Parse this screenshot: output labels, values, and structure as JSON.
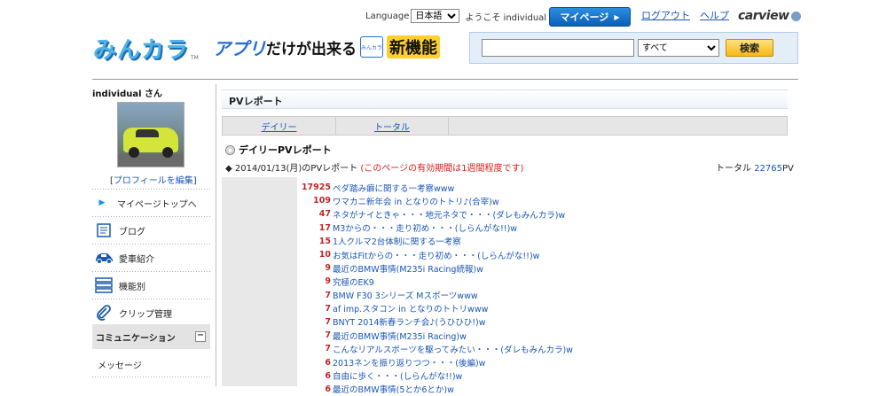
{
  "topbar": {
    "language_label": "Language",
    "language_value": "日本語",
    "welcome": "ようこそ individual さん",
    "mypage_label": "マイページ",
    "logout_label": "ログアウト",
    "help_label": "ヘルプ",
    "carview_logo": "carview"
  },
  "header": {
    "logo_text": "みんカラ",
    "logo_tm": "TM",
    "banner_part1": "アプリ",
    "banner_part2": "だけが出来る",
    "banner_icon_text": "みんカラ",
    "banner_part3": "新機能",
    "search_select_value": "すべて",
    "search_button_label": "検索"
  },
  "sidebar": {
    "user_name": "individual さん",
    "edit_profile_prefix": "[",
    "edit_profile_label": "プロフィールを編集",
    "edit_profile_suffix": "]",
    "items": [
      {
        "label": "マイページトップへ",
        "icon": "triangle-right-icon"
      },
      {
        "label": "ブログ",
        "icon": "notepad-icon"
      },
      {
        "label": "愛車紹介",
        "icon": "car-icon"
      },
      {
        "label": "機能別",
        "icon": "list-icon"
      },
      {
        "label": "クリップ管理",
        "icon": "paperclip-icon"
      }
    ],
    "community_header": "コミュニケーション",
    "community_collapse": "−",
    "message_label": "メッセージ"
  },
  "main": {
    "section_title": "PVレポート",
    "tabs": [
      "デイリー",
      "トータル"
    ],
    "report_heading": "デイリーPVレポート",
    "date_line": "◆ 2014/01/13(月)のPVレポート",
    "date_note": "(このページの有効期間は1週間程度です)",
    "total_label": "トータル",
    "total_value": "22765",
    "total_unit": "PV",
    "rows": [
      {
        "count": "17925",
        "title": "ペダ踏み癖に関する一考察www"
      },
      {
        "count": "109",
        "title": "ワマカニ新年会 in となりのトトリ♪(合宰)w"
      },
      {
        "count": "47",
        "title": "ネタがナイときゃ・・・地元ネタで・・・(ダレもみんカラ)w"
      },
      {
        "count": "17",
        "title": "M3からの・・・走り初め・・・(しらんがな!!)w"
      },
      {
        "count": "15",
        "title": "1人クルマ2台体制に関する一考察"
      },
      {
        "count": "10",
        "title": "お気はFitからの・・・走り初め・・・(しらんがな!!)w"
      },
      {
        "count": "9",
        "title": "最近のBMW事情(M235i Racing続報)w"
      },
      {
        "count": "9",
        "title": "究極のEK9"
      },
      {
        "count": "7",
        "title": "BMW F30 3シリーズ Mスポーツwww"
      },
      {
        "count": "7",
        "title": "af imp.スタコン in となりのトトリwww"
      },
      {
        "count": "7",
        "title": "BNYT 2014新春ランチ会♪(うひひひ!)w"
      },
      {
        "count": "7",
        "title": "最近のBMW事情(M235i Racing)w"
      },
      {
        "count": "7",
        "title": "こんなリアルスポーツを駆ってみたい・・・(ダレもみんカラ)w"
      },
      {
        "count": "6",
        "title": "2013ネンを振り返りつつ・・・(後編)w"
      },
      {
        "count": "6",
        "title": "自由に歩く・・・(しらんがな!!)w"
      },
      {
        "count": "6",
        "title": "最近のBMW事情(5とか6とか)w"
      }
    ]
  }
}
